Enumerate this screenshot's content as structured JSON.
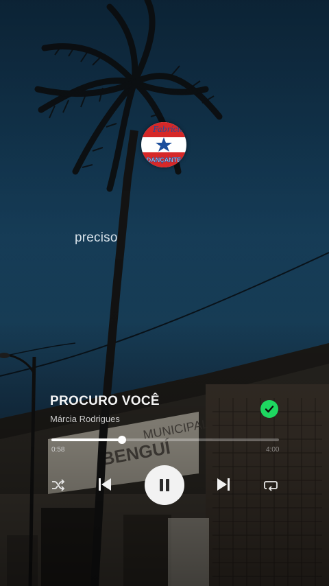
{
  "overlay": {
    "lyric_line": "preciso",
    "logo_text_top": "Fabrício",
    "logo_text_bottom": "DANÇANTE"
  },
  "now_playing": {
    "title": "PROCURO VOCÊ",
    "artist": "Márcia Rodrigues",
    "liked": true,
    "elapsed": "0:58",
    "total": "4:00",
    "progress": 0.31,
    "is_playing": true
  },
  "controls": {
    "shuffle_icon": "shuffle-icon",
    "previous_icon": "skip-previous-icon",
    "play_pause_icon": "pause-icon",
    "next_icon": "skip-next-icon",
    "repeat_icon": "repeat-icon"
  },
  "colors": {
    "accent_green": "#1ed760",
    "text_primary": "#f4f4f4",
    "text_secondary": "#c9c9c9"
  }
}
